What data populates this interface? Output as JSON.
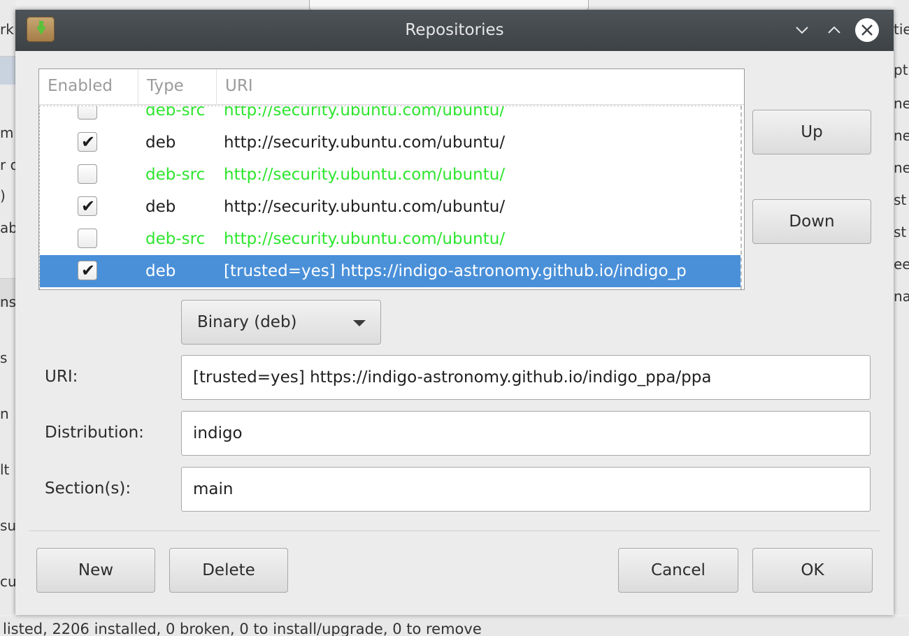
{
  "background": {
    "left_fragments": [
      "rk",
      "m",
      "r o",
      ")",
      "ab",
      "ns",
      "s",
      "n",
      "lt",
      "su",
      "cu"
    ],
    "right_fragments": [
      "tie",
      "pt",
      "ne",
      "ne",
      "ne",
      "st",
      "st",
      "ee",
      "na"
    ],
    "status_text": "listed, 2206 installed, 0 broken, 0 to install/upgrade, 0 to remove"
  },
  "dialog": {
    "title": "Repositories",
    "app_icon": "package-download-icon",
    "titlebar_buttons": [
      "minimize-icon",
      "maximize-icon",
      "close-icon"
    ]
  },
  "table": {
    "columns": [
      "Enabled",
      "Type",
      "URI"
    ],
    "rows": [
      {
        "enabled": false,
        "type": "deb-src",
        "uri": "http://security.ubuntu.com/ubuntu/",
        "color": "#2ee52e"
      },
      {
        "enabled": true,
        "type": "deb",
        "uri": "http://security.ubuntu.com/ubuntu/",
        "color": "#1f1f1f"
      },
      {
        "enabled": false,
        "type": "deb-src",
        "uri": "http://security.ubuntu.com/ubuntu/",
        "color": "#2ee52e"
      },
      {
        "enabled": true,
        "type": "deb",
        "uri": "http://security.ubuntu.com/ubuntu/",
        "color": "#1f1f1f"
      },
      {
        "enabled": false,
        "type": "deb-src",
        "uri": "http://security.ubuntu.com/ubuntu/",
        "color": "#2ee52e"
      },
      {
        "enabled": true,
        "type": "deb",
        "uri": "[trusted=yes] https://indigo-astronomy.github.io/indigo_p",
        "color": "#ffffff",
        "selected": true
      }
    ],
    "selection_color": "#4a90d9"
  },
  "buttons": {
    "up": "Up",
    "down": "Down",
    "new": "New",
    "delete": "Delete",
    "cancel": "Cancel",
    "ok": "OK"
  },
  "form": {
    "type_select": "Binary (deb)",
    "uri_label": "URI:",
    "uri_value": "[trusted=yes] https://indigo-astronomy.github.io/indigo_ppa/ppa",
    "distribution_label": "Distribution:",
    "distribution_value": "indigo",
    "sections_label": "Section(s):",
    "sections_value": "main"
  }
}
